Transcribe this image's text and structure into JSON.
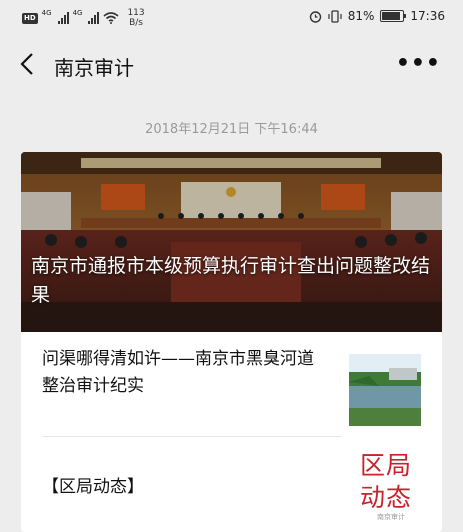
{
  "status_bar": {
    "hd": "HD",
    "sim1": "4G",
    "sim2": "4G",
    "speed_value": "113",
    "speed_unit": "B/s",
    "battery": "81%",
    "time": "17:36"
  },
  "nav": {
    "title": "南京审计",
    "more": "•••"
  },
  "message": {
    "timestamp": "2018年12月21日 下午16:44"
  },
  "article": {
    "cover_title": "南京市通报市本级预算执行审计查出问题整改结果"
  },
  "sub_articles": [
    {
      "title": "问渠哪得清如许——南京市黑臭河道整治审计纪实"
    },
    {
      "title": "【区局动态】",
      "thumb_text": "区局动态",
      "thumb_watermark": "南京审计"
    }
  ]
}
